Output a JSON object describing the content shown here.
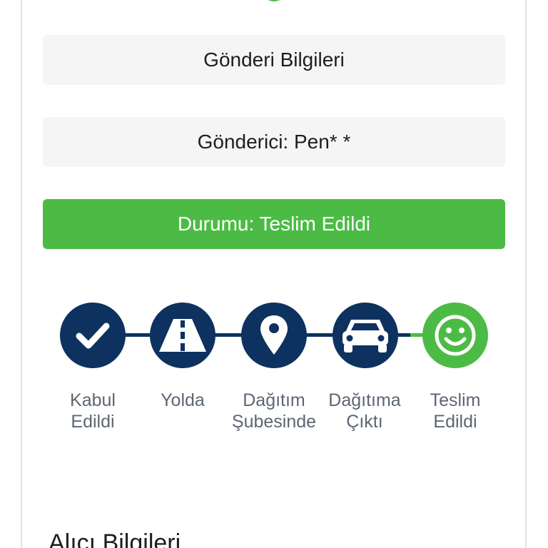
{
  "shipment_info": {
    "title": "Gönderi Bilgileri",
    "sender_label": "Gönderici: Pen* *"
  },
  "status": {
    "text": "Durumu: Teslim Edildi",
    "color": "#4cbb45"
  },
  "tracker": {
    "active_color": "#0d3260",
    "final_color": "#4cbb45",
    "steps": [
      {
        "icon": "check-icon",
        "line1": "Kabul",
        "line2": "Edildi"
      },
      {
        "icon": "road-icon",
        "line1": "Yolda",
        "line2": ""
      },
      {
        "icon": "map-pin-icon",
        "line1": "Dağıtım",
        "line2": "Şubesinde"
      },
      {
        "icon": "car-icon",
        "line1": "Dağıtıma",
        "line2": "Çıktı"
      },
      {
        "icon": "smiley-icon",
        "line1": "Teslim",
        "line2": "Edildi"
      }
    ]
  },
  "recipient": {
    "section_title": "Alıcı Bilgileri"
  }
}
